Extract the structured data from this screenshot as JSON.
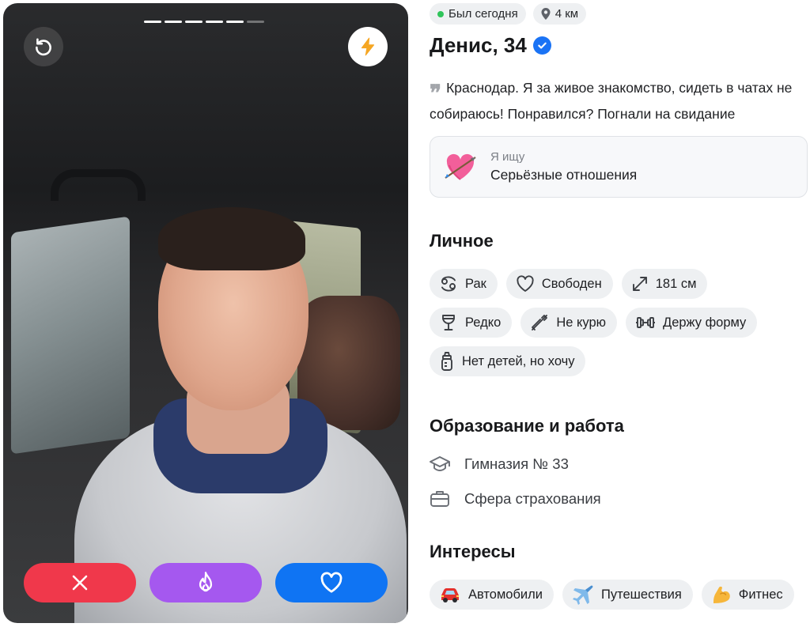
{
  "photo": {
    "progress_total": 6,
    "progress_active": 5
  },
  "actions": {
    "undo_icon": "undo-icon",
    "boost_icon": "lightning-icon",
    "dislike_icon": "close-icon",
    "superlike_icon": "flame-icon",
    "like_icon": "heart-icon"
  },
  "profile": {
    "status": "Был сегодня",
    "distance": "4 км",
    "name": "Денис, 34",
    "bio": "Краснодар. Я за живое знакомство, сидеть в чатах не собираюсь! Понравился? Погнали на свидание",
    "looking_for": {
      "label": "Я ищу",
      "value": "Серьёзные отношения"
    }
  },
  "personal": {
    "title": "Личное",
    "items": [
      {
        "label": "Рак",
        "icon": "cancer-zodiac-icon"
      },
      {
        "label": "Свободен",
        "icon": "heart-outline-icon"
      },
      {
        "label": "181 см",
        "icon": "height-arrows-icon"
      },
      {
        "label": "Редко",
        "icon": "wine-glass-icon"
      },
      {
        "label": "Не курю",
        "icon": "no-smoking-icon"
      },
      {
        "label": "Держу форму",
        "icon": "dumbbell-icon"
      },
      {
        "label": "Нет детей, но хочу",
        "icon": "baby-bottle-icon"
      }
    ]
  },
  "education": {
    "title": "Образование и работа",
    "school": "Гимназия № 33",
    "work": "Сфера страхования"
  },
  "interests": {
    "title": "Интересы",
    "items": [
      {
        "label": "Автомобили",
        "icon": "car-icon"
      },
      {
        "label": "Путешествия",
        "icon": "airplane-icon"
      },
      {
        "label": "Фитнес",
        "icon": "biceps-icon"
      }
    ]
  },
  "colors": {
    "dislike": "#f0384b",
    "superlike": "#a558ef",
    "like": "#0f74f3",
    "verified": "#1a73f5",
    "online": "#2fc45a"
  }
}
